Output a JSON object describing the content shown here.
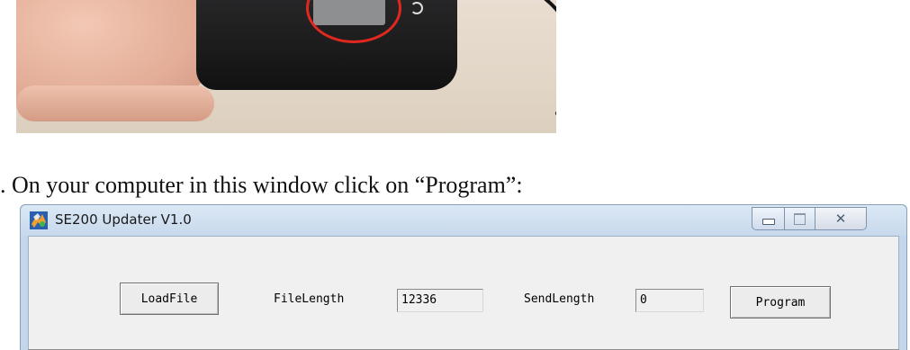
{
  "caption": ". On your computer in this window click on “Program”:",
  "window": {
    "title": "SE200 Updater V1.0",
    "icon": "app-icon",
    "controls": {
      "minimize": "minimize-icon",
      "maximize": "maximize-icon",
      "close": "close-icon"
    }
  },
  "form": {
    "load_button": "LoadFile",
    "file_length_label": "FileLength",
    "file_length_value": "12336",
    "send_length_label": "SendLength",
    "send_length_value": "0",
    "program_button": "Program"
  },
  "colors": {
    "annotation_circle": "#e0281f",
    "titlebar": "#c7d9ec"
  }
}
